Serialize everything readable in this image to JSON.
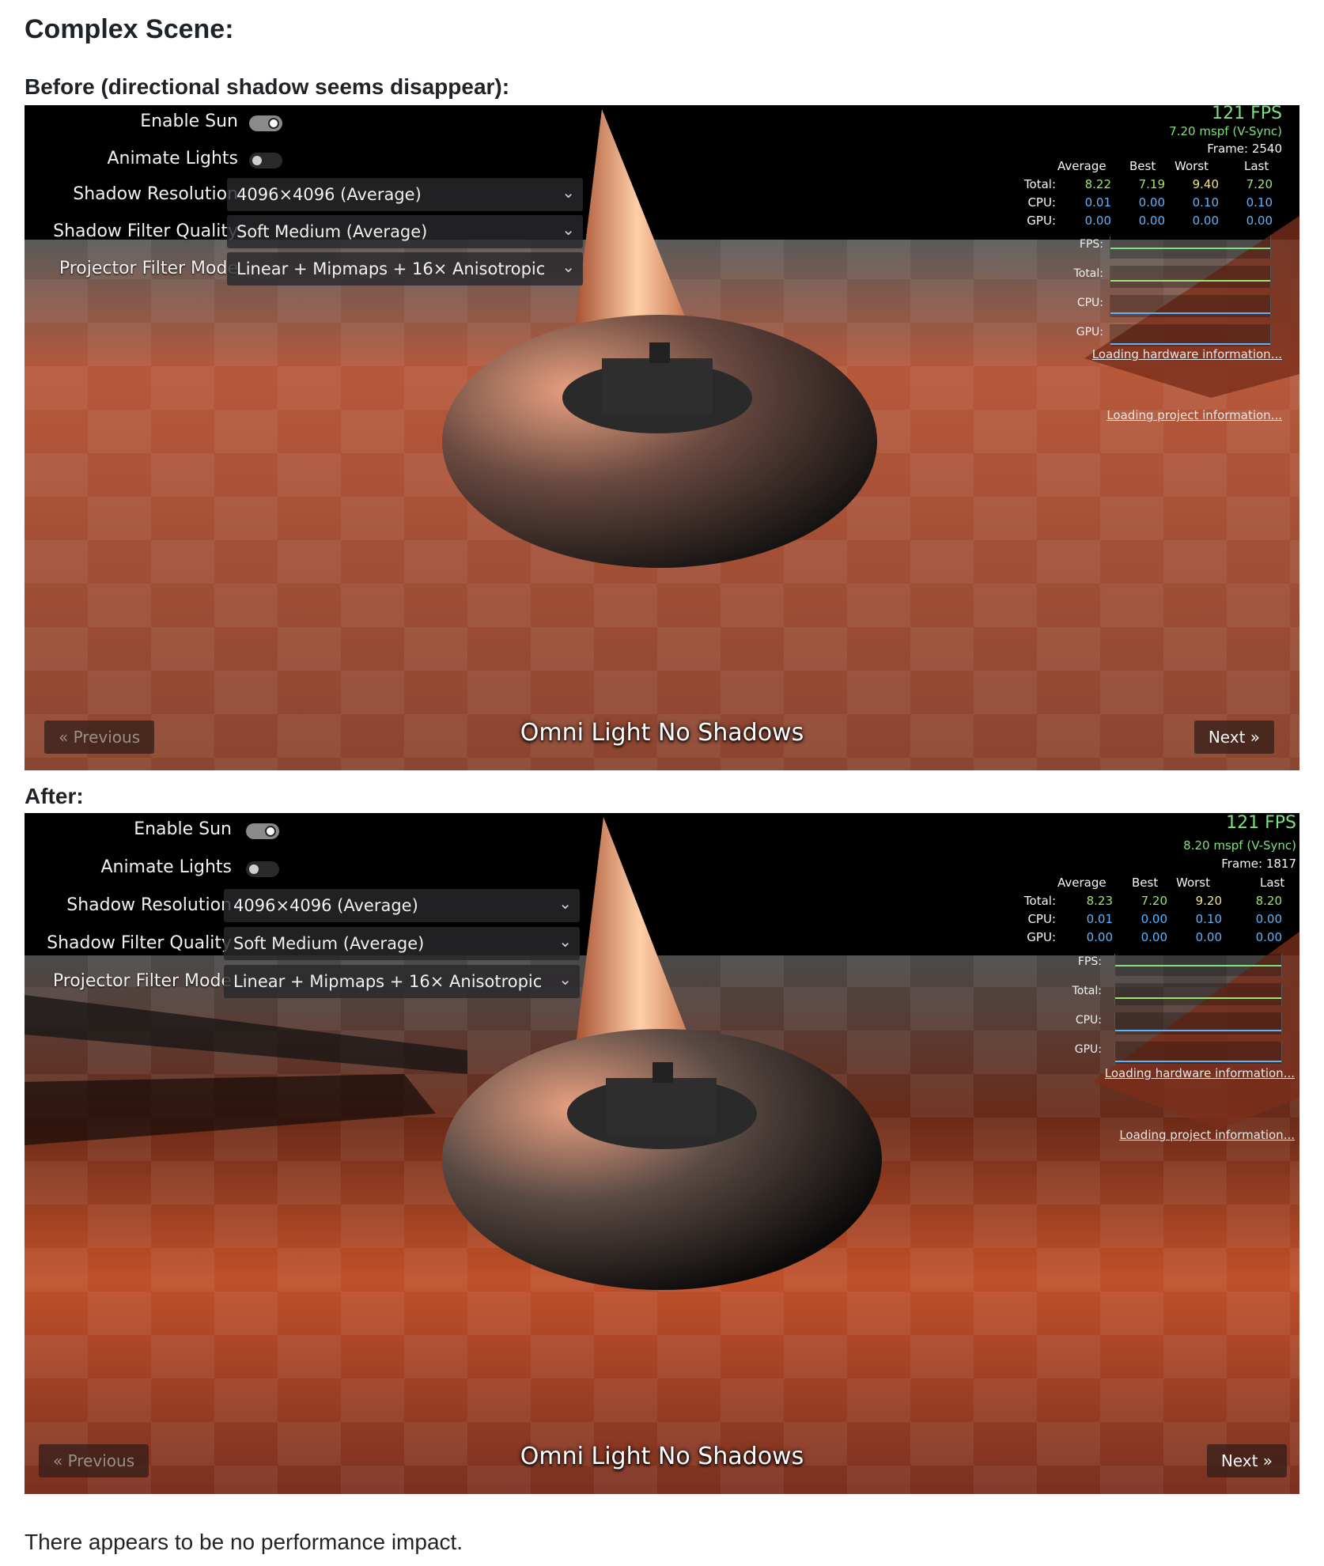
{
  "page": {
    "heading": "Complex Scene:",
    "before_caption": "Before (directional shadow seems disappear):",
    "after_caption": "After:",
    "footer": "There appears to be no performance impact."
  },
  "before": {
    "settings": {
      "enable_sun_label": "Enable Sun",
      "enable_sun_on": true,
      "animate_lights_label": "Animate Lights",
      "animate_lights_on": false,
      "shadow_resolution_label": "Shadow Resolution",
      "shadow_resolution_value": "4096×4096 (Average)",
      "shadow_filter_label": "Shadow Filter Quality",
      "shadow_filter_value": "Soft Medium (Average)",
      "projector_filter_label": "Projector Filter Mode",
      "projector_filter_value": "Linear + Mipmaps + 16× Anisotropic"
    },
    "perf": {
      "fps": "121 FPS",
      "mspf": "7.20 mspf (V-Sync)",
      "frame": "Frame: 2540",
      "headers": [
        "Average",
        "Best",
        "Worst",
        "Last"
      ],
      "rows": [
        {
          "label": "Total:",
          "values": [
            "8.22",
            "7.19",
            "9.40",
            "7.20"
          ]
        },
        {
          "label": "CPU:",
          "values": [
            "0.01",
            "0.00",
            "0.10",
            "0.10"
          ]
        },
        {
          "label": "GPU:",
          "values": [
            "0.00",
            "0.00",
            "0.00",
            "0.00"
          ]
        }
      ],
      "graphs": [
        "FPS:",
        "Total:",
        "CPU:",
        "GPU:"
      ],
      "loading_hardware": "Loading hardware information...",
      "loading_project": "Loading project information..."
    },
    "nav": {
      "previous": "« Previous",
      "next": "Next »",
      "scene_name": "Omni Light No Shadows"
    }
  },
  "after": {
    "settings": {
      "enable_sun_label": "Enable Sun",
      "enable_sun_on": true,
      "animate_lights_label": "Animate Lights",
      "animate_lights_on": false,
      "shadow_resolution_label": "Shadow Resolution",
      "shadow_resolution_value": "4096×4096 (Average)",
      "shadow_filter_label": "Shadow Filter Quality",
      "shadow_filter_value": "Soft Medium (Average)",
      "projector_filter_label": "Projector Filter Mode",
      "projector_filter_value": "Linear + Mipmaps + 16× Anisotropic"
    },
    "perf": {
      "fps": "121 FPS",
      "mspf": "8.20 mspf (V-Sync)",
      "frame": "Frame: 1817",
      "headers": [
        "Average",
        "Best",
        "Worst",
        "Last"
      ],
      "rows": [
        {
          "label": "Total:",
          "values": [
            "8.23",
            "7.20",
            "9.20",
            "8.20"
          ]
        },
        {
          "label": "CPU:",
          "values": [
            "0.01",
            "0.00",
            "0.10",
            "0.00"
          ]
        },
        {
          "label": "GPU:",
          "values": [
            "0.00",
            "0.00",
            "0.00",
            "0.00"
          ]
        }
      ],
      "graphs": [
        "FPS:",
        "Total:",
        "CPU:",
        "GPU:"
      ],
      "loading_hardware": "Loading hardware information...",
      "loading_project": "Loading project information..."
    },
    "nav": {
      "previous": "« Previous",
      "next": "Next »",
      "scene_name": "Omni Light No Shadows"
    }
  },
  "colors": {
    "fps_green": "#7fe07f",
    "stat_green": "#9be56a",
    "stat_yellow": "#f2e57e",
    "stat_blue": "#5ab4ff",
    "floor_orange": "#c8603c"
  }
}
